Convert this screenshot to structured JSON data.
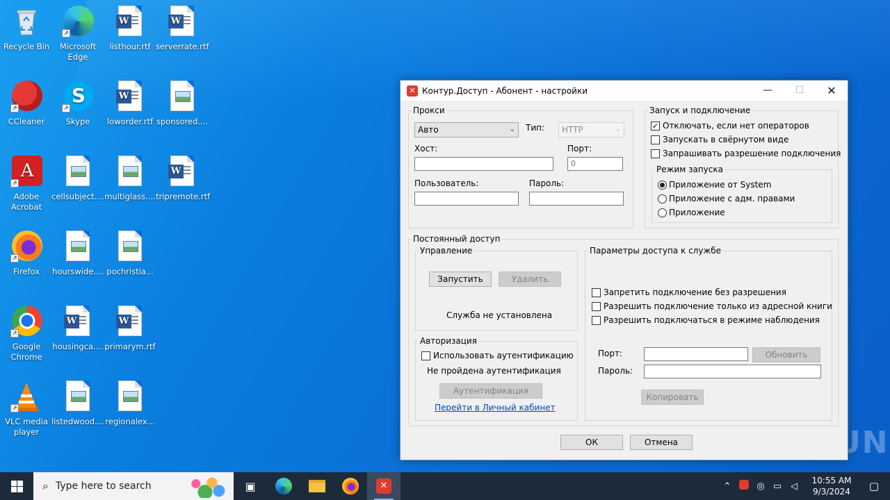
{
  "desktop": {
    "icons": [
      {
        "label": "Recycle Bin",
        "icon": "recycle-bin-icon"
      },
      {
        "label": "Microsoft Edge",
        "icon": "edge-icon"
      },
      {
        "label": "listhour.rtf",
        "icon": "word-doc-icon"
      },
      {
        "label": "serverrate.rtf",
        "icon": "word-doc-icon"
      },
      {
        "label": "CCleaner",
        "icon": "ccleaner-icon"
      },
      {
        "label": "Skype",
        "icon": "skype-icon"
      },
      {
        "label": "loworder.rtf",
        "icon": "word-doc-icon"
      },
      {
        "label": "sponsored....",
        "icon": "image-file-icon"
      },
      {
        "label": "Adobe Acrobat",
        "icon": "acrobat-icon"
      },
      {
        "label": "cellsubject....",
        "icon": "image-file-icon"
      },
      {
        "label": "multiglass....",
        "icon": "image-file-icon"
      },
      {
        "label": "tripremote.rtf",
        "icon": "word-doc-icon"
      },
      {
        "label": "Firefox",
        "icon": "firefox-icon"
      },
      {
        "label": "hourswide....",
        "icon": "image-file-icon"
      },
      {
        "label": "pochristia...",
        "icon": "image-file-icon"
      },
      {
        "label": "Google Chrome",
        "icon": "chrome-icon"
      },
      {
        "label": "housingca....",
        "icon": "word-doc-icon"
      },
      {
        "label": "primarym.rtf",
        "icon": "word-doc-icon"
      },
      {
        "label": "VLC media player",
        "icon": "vlc-icon"
      },
      {
        "label": "listedwood....",
        "icon": "image-file-icon"
      },
      {
        "label": "regionalex...",
        "icon": "image-file-icon"
      }
    ]
  },
  "dialog": {
    "title": "Контур.Доступ - Абонент - настройки",
    "proxy": {
      "legend": "Прокси",
      "mode_value": "Авто",
      "type_label": "Тип:",
      "type_value": "HTTP",
      "host_label": "Хост:",
      "host_value": "",
      "port_label": "Порт:",
      "port_value": "0",
      "user_label": "Пользователь:",
      "user_value": "",
      "password_label": "Пароль:",
      "password_value": ""
    },
    "launch": {
      "legend": "Запуск и подключение",
      "options": [
        {
          "label": "Отключать, если нет операторов",
          "checked": true
        },
        {
          "label": "Запускать в свёрнутом виде",
          "checked": false
        },
        {
          "label": "Запрашивать разрешение подключения",
          "checked": false
        }
      ],
      "mode_legend": "Режим запуска",
      "modes": [
        {
          "label": "Приложение от System",
          "selected": true
        },
        {
          "label": "Приложение с адм. правами",
          "selected": false
        },
        {
          "label": "Приложение",
          "selected": false
        }
      ]
    },
    "permanent": {
      "legend": "Постоянный доступ",
      "control_legend": "Управление",
      "start_button": "Запустить",
      "delete_button": "Удалить",
      "service_status": "Служба не установлена",
      "auth_legend": "Авторизация",
      "use_auth_label": "Использовать аутентификацию",
      "auth_status": "Не пройдена аутентификация",
      "auth_button": "Аутентификация",
      "cabinet_link": "Перейти в Личный кабинет",
      "service_legend": "Параметры доступа к службе",
      "service_options": [
        {
          "label": "Запретить подключение без разрешения",
          "checked": false
        },
        {
          "label": "Разрешить подключение только из адресной книги",
          "checked": false
        },
        {
          "label": "Разрешить подключаться в режиме наблюдения",
          "checked": false
        }
      ],
      "port_label": "Порт:",
      "port_value": "",
      "update_button": "Обновить",
      "password_label": "Пароль:",
      "password_value": "",
      "copy_button": "Копировать"
    },
    "ok_button": "ОК",
    "cancel_button": "Отмена"
  },
  "watermark": "ANY RUN",
  "taskbar": {
    "search_placeholder": "Type here to search",
    "time": "10:55 AM",
    "date": "9/3/2024"
  }
}
